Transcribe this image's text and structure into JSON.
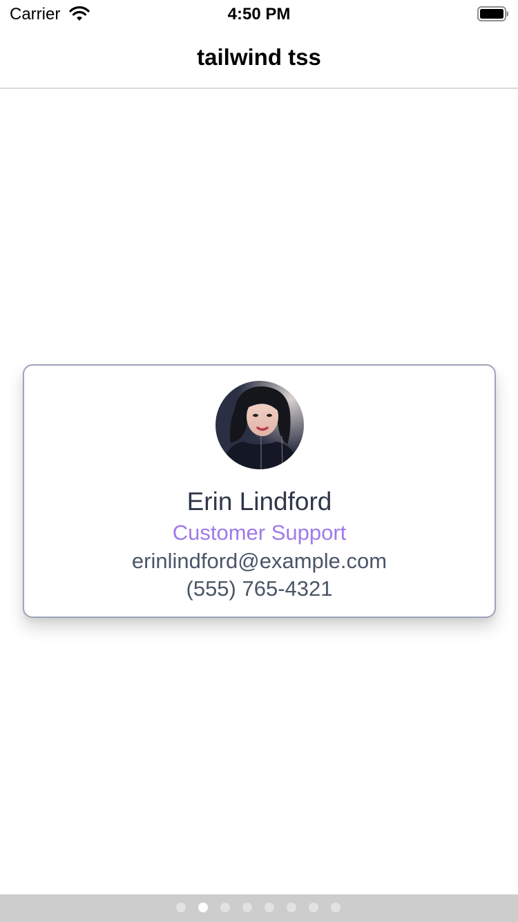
{
  "status_bar": {
    "carrier": "Carrier",
    "time": "4:50 PM"
  },
  "nav": {
    "title": "tailwind tss"
  },
  "card": {
    "name": "Erin Lindford",
    "role": "Customer Support",
    "email": "erinlindford@example.com",
    "phone": "(555) 765-4321",
    "avatar": "avatar-photo",
    "colors": {
      "name": "#2d3748",
      "role": "#9f7aea",
      "detail": "#4a5568",
      "border": "#9ea3b8"
    }
  },
  "page_control": {
    "page_count": 8,
    "current_page": 2
  }
}
